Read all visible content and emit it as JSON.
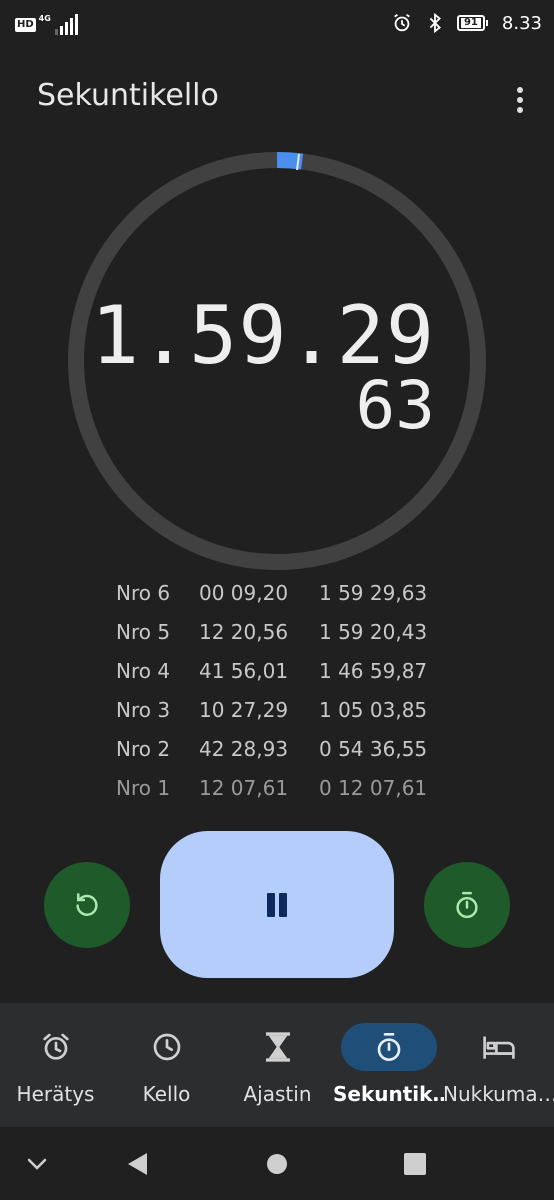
{
  "status_bar": {
    "hd": "HD",
    "network": "4G",
    "battery": "91",
    "time": "8.33",
    "icons": [
      "signal-icon",
      "alarm-icon",
      "bluetooth-icon",
      "battery-icon"
    ]
  },
  "header": {
    "title": "Sekuntikello",
    "overflow_icon": "more-vert-icon"
  },
  "stopwatch": {
    "main": "1.59.29",
    "hundredths": "63",
    "progress_fraction": 0.02,
    "colors": {
      "track": "#414141",
      "progress": "#4a8ef0"
    }
  },
  "laps": [
    {
      "no": "Nro 6",
      "split": "00 09,20",
      "total": "1 59 29,63"
    },
    {
      "no": "Nro 5",
      "split": "12 20,56",
      "total": "1 59 20,43"
    },
    {
      "no": "Nro 4",
      "split": "41 56,01",
      "total": "1 46 59,87"
    },
    {
      "no": "Nro 3",
      "split": "10 27,29",
      "total": "1 05 03,85"
    },
    {
      "no": "Nro 2",
      "split": "42 28,93",
      "total": "0 54 36,55"
    },
    {
      "no": "Nro 1",
      "split": "12 07,61",
      "total": "0 12 07,61"
    }
  ],
  "controls": {
    "reset_icon": "reset-icon",
    "pause_icon": "pause-icon",
    "lap_icon": "stopwatch-lap-icon"
  },
  "nav": [
    {
      "label": "Herätys",
      "icon": "alarm-icon"
    },
    {
      "label": "Kello",
      "icon": "clock-icon"
    },
    {
      "label": "Ajastin",
      "icon": "hourglass-icon"
    },
    {
      "label": "Sekuntik…",
      "icon": "stopwatch-icon",
      "active": true
    },
    {
      "label": "Nukkuma…",
      "icon": "bed-icon"
    }
  ]
}
